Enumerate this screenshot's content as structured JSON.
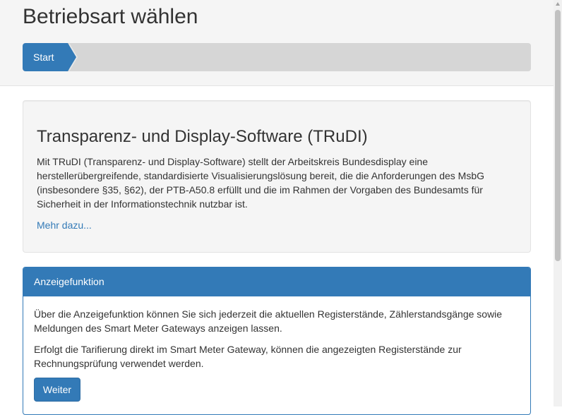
{
  "header": {
    "title": "Betriebsart wählen",
    "steps": [
      {
        "label": "Start",
        "active": true
      }
    ]
  },
  "intro": {
    "title": "Transparenz- und Display-Software (TRuDI)",
    "text": "Mit TRuDI (Transparenz- und Display-Software) stellt der Arbeitskreis Bundesdisplay eine herstellerübergreifende, standardisierte Visualisierungslösung bereit, die die Anforderungen des MsbG (insbesondere §35, §62), der PTB-A50.8 erfüllt und die im Rahmen der Vorgaben des Bundesamts für Sicherheit in der Informationstechnik nutzbar ist.",
    "more_link": "Mehr dazu..."
  },
  "panel": {
    "heading": "Anzeigefunktion",
    "paragraph1": "Über die Anzeigefunktion können Sie sich jederzeit die aktuellen Registerstände, Zählerstandsgänge sowie Meldungen des Smart Meter Gateways anzeigen lassen.",
    "paragraph2": "Erfolgt die Tarifierung direkt im Smart Meter Gateway, können die angezeigten Registerstände zur Rechnungsprüfung verwendet werden.",
    "button_label": "Weiter"
  },
  "colors": {
    "primary": "#337ab7",
    "header_bg": "#f5f5f5",
    "progress_bg": "#d6d6d6"
  }
}
